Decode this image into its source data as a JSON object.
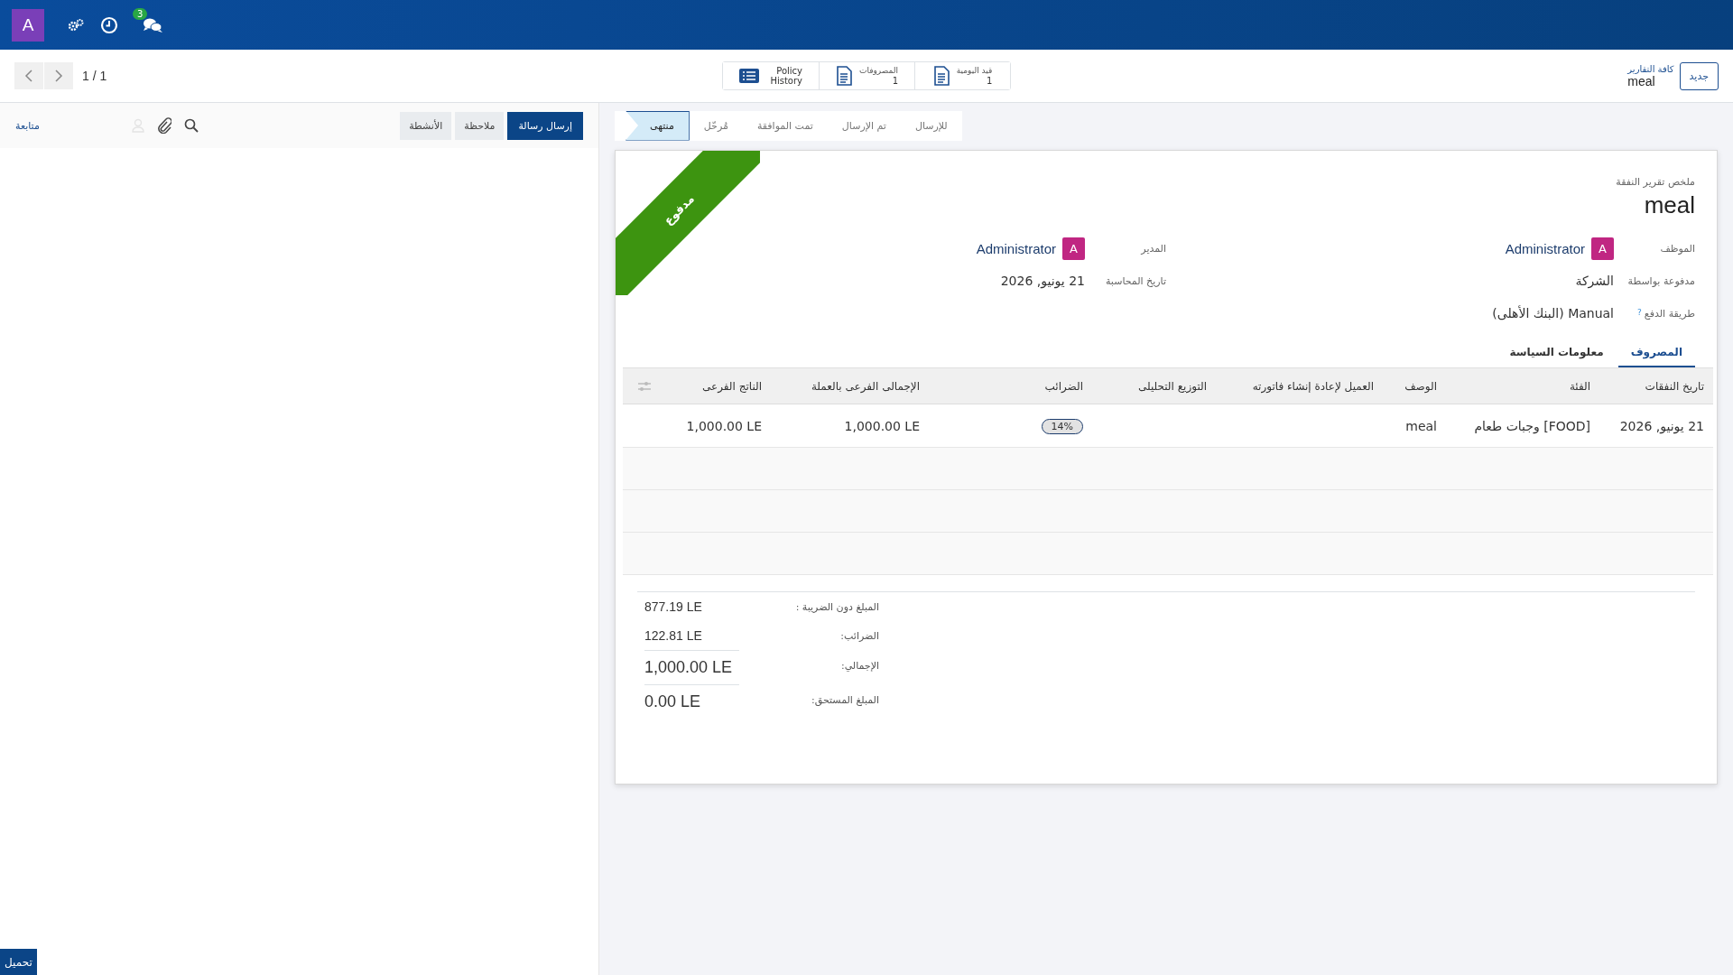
{
  "navbar": {
    "avatar": "A",
    "chat_badge": "3"
  },
  "pager": {
    "value": "1 / 1"
  },
  "smart_buttons": [
    {
      "kind": "doc",
      "label": "قيد اليومية",
      "count": "1"
    },
    {
      "kind": "doc",
      "label": "المصروفات",
      "count": "1"
    },
    {
      "kind": "list",
      "label": "Policy History"
    }
  ],
  "breadcrumb": {
    "parent": "كافة التقارير",
    "current": "meal"
  },
  "new_button": "جديد",
  "statusbar": [
    {
      "label": "للإرسال",
      "selected": false
    },
    {
      "label": "تم الإرسال",
      "selected": false
    },
    {
      "label": "تمت الموافقة",
      "selected": false
    },
    {
      "label": "مُرحّل",
      "selected": false
    },
    {
      "label": "منتهى",
      "selected": true
    }
  ],
  "ribbon": "مدفوع",
  "sheet": {
    "subtitle": "ملخص تقرير النفقة",
    "title": "meal"
  },
  "fields_right": [
    {
      "kind": "user",
      "label": "الموظف",
      "avatar": "A",
      "value": "Administrator"
    },
    {
      "kind": "text",
      "label": "مدفوعة بواسطة",
      "value": "الشركة"
    },
    {
      "kind": "help",
      "label": "طريقة الدفع",
      "help": "?",
      "value": "Manual (البنك الأهلى)"
    }
  ],
  "fields_left": [
    {
      "kind": "user",
      "label": "المدير",
      "avatar": "A",
      "value": "Administrator"
    },
    {
      "kind": "text",
      "label": "تاريخ المحاسبة",
      "value": "21 يونيو, 2026"
    }
  ],
  "notebook_tabs": [
    {
      "label": "المصروف",
      "selected": true
    },
    {
      "label": "معلومات السياسة",
      "selected": false
    }
  ],
  "table": {
    "columns": [
      "تاريخ النفقات",
      "الفئة",
      "الوصف",
      "العميل لإعادة إنشاء فاتورته",
      "التوزيع التحليلى",
      "الضرائب",
      "الإجمالى الفرعى بالعملة",
      "الناتج الفرعى"
    ],
    "rows": [
      {
        "cells": [
          {
            "kind": "text",
            "value": "21 يونيو, 2026"
          },
          {
            "kind": "text",
            "value": "[FOOD] وجبات طعام"
          },
          {
            "kind": "text",
            "value": "meal"
          },
          {
            "kind": "empty"
          },
          {
            "kind": "empty"
          },
          {
            "kind": "badge",
            "value": "14%"
          },
          {
            "kind": "amount",
            "value": "1,000.00 LE"
          },
          {
            "kind": "amount",
            "value": "1,000.00 LE"
          }
        ]
      }
    ]
  },
  "totals": [
    {
      "kind": "normal",
      "label": "المبلغ دون الضريبة :",
      "value": "877.19 LE"
    },
    {
      "kind": "normal",
      "label": "الضرائب:",
      "value": "122.81 LE"
    },
    {
      "kind": "major",
      "label": "الإجمالي:",
      "value": "1,000.00 LE"
    },
    {
      "kind": "major",
      "label": "المبلغ المستحق:",
      "value": "0.00 LE"
    }
  ],
  "chatter": {
    "buttons": [
      {
        "label": "إرسال رسالة",
        "selected": true
      },
      {
        "label": "ملاحظة",
        "selected": false
      },
      {
        "label": "الأنشطة",
        "selected": false
      }
    ],
    "follow": "متابعة"
  },
  "download_button": "تحميل"
}
